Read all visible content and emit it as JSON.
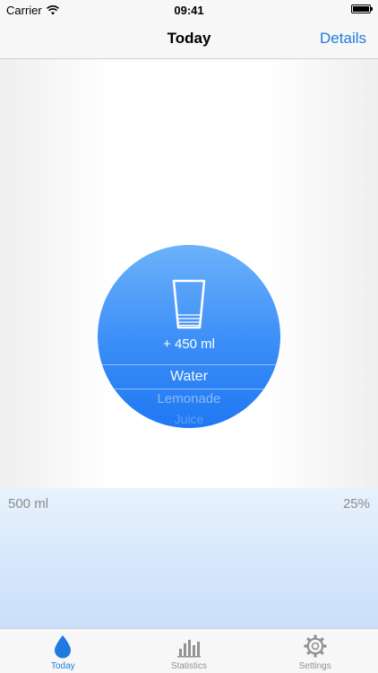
{
  "status_bar": {
    "carrier": "Carrier",
    "time": "09:41"
  },
  "nav": {
    "title": "Today",
    "details_label": "Details"
  },
  "drink": {
    "amount": "+ 450 ml",
    "picker": {
      "selected": "Water",
      "next": "Lemonade",
      "third": "Juice"
    }
  },
  "progress": {
    "goal": "500 ml",
    "percent_label": "25%",
    "percent": 25
  },
  "tabs": [
    {
      "label": "Today",
      "icon": "drop-icon",
      "active": true
    },
    {
      "label": "Statistics",
      "icon": "bar-chart-icon",
      "active": false
    },
    {
      "label": "Settings",
      "icon": "gear-icon",
      "active": false
    }
  ],
  "colors": {
    "accent": "#1f7ae0",
    "circle_top": "#6cb2fb",
    "circle_bottom": "#1f78f3",
    "progress_fill": "#d4e6fb"
  }
}
